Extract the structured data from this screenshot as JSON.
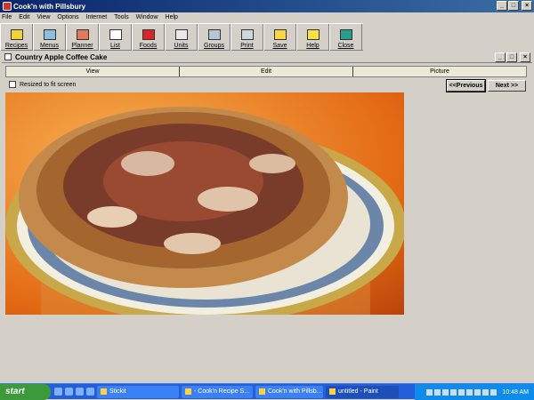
{
  "window": {
    "title": "Cook'n with Pillsbury"
  },
  "menu": [
    "File",
    "Edit",
    "View",
    "Options",
    "Internet",
    "Tools",
    "Window",
    "Help"
  ],
  "toolbar": [
    {
      "label": "Recipes",
      "icon": "recipes-icon",
      "color": "#f2d335"
    },
    {
      "label": "Menus",
      "icon": "menus-icon",
      "color": "#8fbfe0"
    },
    {
      "label": "Planner",
      "icon": "planner-icon",
      "color": "#e07a5f"
    },
    {
      "label": "List",
      "icon": "list-icon",
      "color": "#ffffff"
    },
    {
      "label": "Foods",
      "icon": "foods-icon",
      "color": "#d62828"
    },
    {
      "label": "Units",
      "icon": "units-icon",
      "color": "#e9e9e9"
    },
    {
      "label": "Groups",
      "icon": "groups-icon",
      "color": "#b5c7d3"
    },
    {
      "label": "Print",
      "icon": "print-icon",
      "color": "#cfd8dc"
    },
    {
      "label": "Save",
      "icon": "save-icon",
      "color": "#f6d743"
    },
    {
      "label": "Help",
      "icon": "help-icon",
      "color": "#fde047"
    },
    {
      "label": "Close",
      "icon": "close-icon",
      "color": "#2a9d8f"
    }
  ],
  "recipe": {
    "title": "Country Apple Coffee Cake",
    "tabs": [
      "View",
      "Edit",
      "Picture"
    ],
    "resize_label": "Resized to fit screen",
    "prev_label": "<<Previous",
    "next_label": "Next >>"
  },
  "taskbar": {
    "start_label": "start",
    "tasks": [
      "Stickit",
      "- Cook'n Recipe S...",
      "Cook'n with Pillsb...",
      "untitled - Paint"
    ],
    "clock": "10:48 AM"
  }
}
